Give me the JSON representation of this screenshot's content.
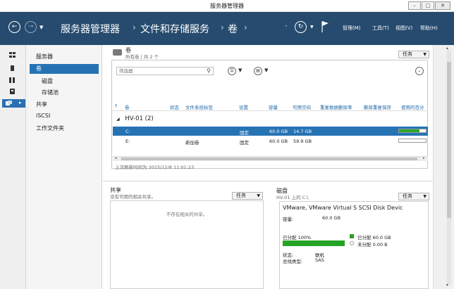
{
  "window": {
    "title": "服务器管理器",
    "minimize": "–",
    "maximize": "□",
    "close": "✕"
  },
  "header": {
    "breadcrumb": [
      "服务器管理器",
      "文件和存储服务",
      "卷"
    ],
    "separator": "›",
    "menus": {
      "manage": "管理(M)",
      "tools": "工具(T)",
      "view": "视图(V)",
      "help": "帮助(H)"
    }
  },
  "nav": {
    "items": {
      "servers": "服务器",
      "volumes": "卷",
      "disks": "磁盘",
      "storage_pools": "存储池",
      "shares": "共享",
      "iscsi": "iSCSI",
      "work_folders": "工作文件夹"
    }
  },
  "volumes": {
    "title": "卷",
    "subtitle": "所有卷 | 共 2 个",
    "tasks": "任务",
    "filter_placeholder": "筛选器",
    "columns": [
      "卷",
      "状态",
      "文件系统标签",
      "设置",
      "容量",
      "可用空间",
      "重复数据删除率",
      "删除重复保存",
      "使用的百分"
    ],
    "group": "HV-01 (2)",
    "rows": [
      {
        "volume": "C:",
        "status": "",
        "label": "",
        "setting": "固定",
        "capacity": "60.0 GB",
        "free": "14.7 GB",
        "used_fraction": 0.76
      },
      {
        "volume": "E:",
        "status": "",
        "label": "新加卷",
        "setting": "固定",
        "capacity": "60.0 GB",
        "free": "59.9 GB",
        "used_fraction": 0.002
      }
    ],
    "last_refresh": "上次刷新时间为 2015/12/8 11:01:23"
  },
  "shares": {
    "title": "共享",
    "subtitle": "没有可用的相关共享。",
    "tasks": "任务",
    "empty_message": "不存在相关的共享。"
  },
  "disk": {
    "title": "磁盘",
    "subtitle": "HV-01 上的 C:\\",
    "tasks": "任务",
    "name": "VMware, VMware Virtual S SCSI Disk Devic",
    "capacity_label": "容量:",
    "capacity_value": "60.0 GB",
    "allocated_label": "已分配 100%",
    "allocated_fraction": 1.0,
    "legend_allocated": "已分配 60.0 GB",
    "legend_unallocated": "未分配 0.00 B",
    "status_label": "状态:",
    "status_value": "联机",
    "bus_label": "总线类型:",
    "bus_value": "SAS"
  },
  "colors": {
    "header_bg": "#264b6f",
    "selection": "#2673b4",
    "usage_green": "#2aa52a"
  }
}
